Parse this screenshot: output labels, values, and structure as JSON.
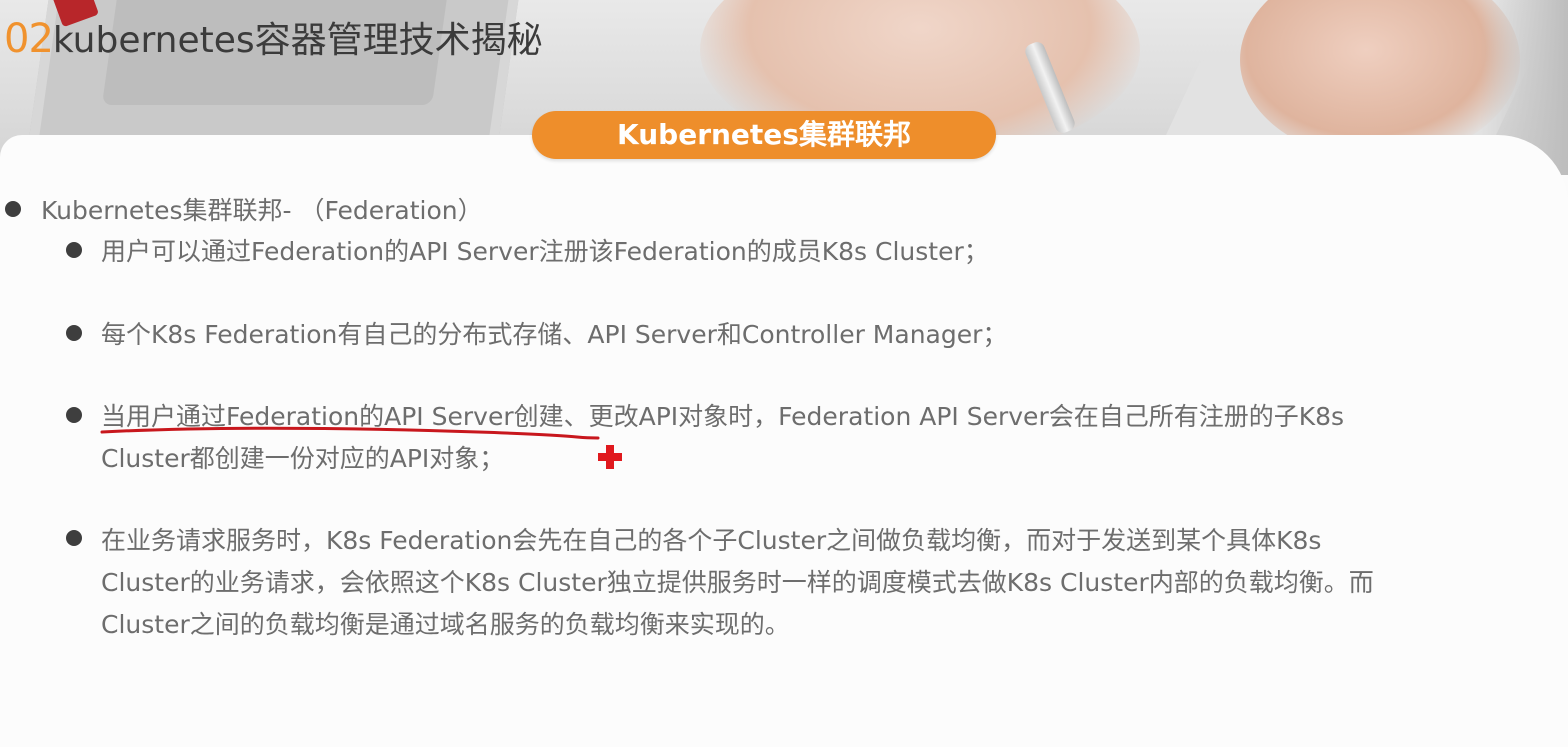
{
  "slide": {
    "title_number": "02",
    "title_text": "kubernetes容器管理技术揭秘"
  },
  "section": {
    "pill_label": "Kubernetes集群联邦"
  },
  "bullets": {
    "level1": "Kubernetes集群联邦- （Federation）",
    "items": [
      {
        "lines": [
          "用户可以通过Federation的API Server注册该Federation的成员K8s Cluster；"
        ]
      },
      {
        "lines": [
          "每个K8s Federation有自己的分布式存储、API Server和Controller Manager；"
        ]
      },
      {
        "lines": [
          "当用户通过Federation的API Server创建、更改API对象时，Federation API Server会在自己所有注册的子K8s",
          "Cluster都创建一份对应的API对象；"
        ]
      },
      {
        "lines": [
          "在业务请求服务时，K8s Federation会先在自己的各个子Cluster之间做负载均衡，而对于发送到某个具体K8s",
          "Cluster的业务请求，会依照这个K8s Cluster独立提供服务时一样的调度模式去做K8s Cluster内部的负载均衡。而",
          "Cluster之间的负载均衡是通过域名服务的负载均衡来实现的。"
        ]
      }
    ]
  },
  "annotations": {
    "underline_color": "#c8171d",
    "cursor_icon": "red-cross-cursor-icon",
    "cursor_color": "#e0191e"
  },
  "colors": {
    "accent_orange": "#ee8e2b",
    "title_number_orange": "#f0922e",
    "body_text": "#6d6d6d",
    "bullet_dot": "#3e3e3e"
  }
}
